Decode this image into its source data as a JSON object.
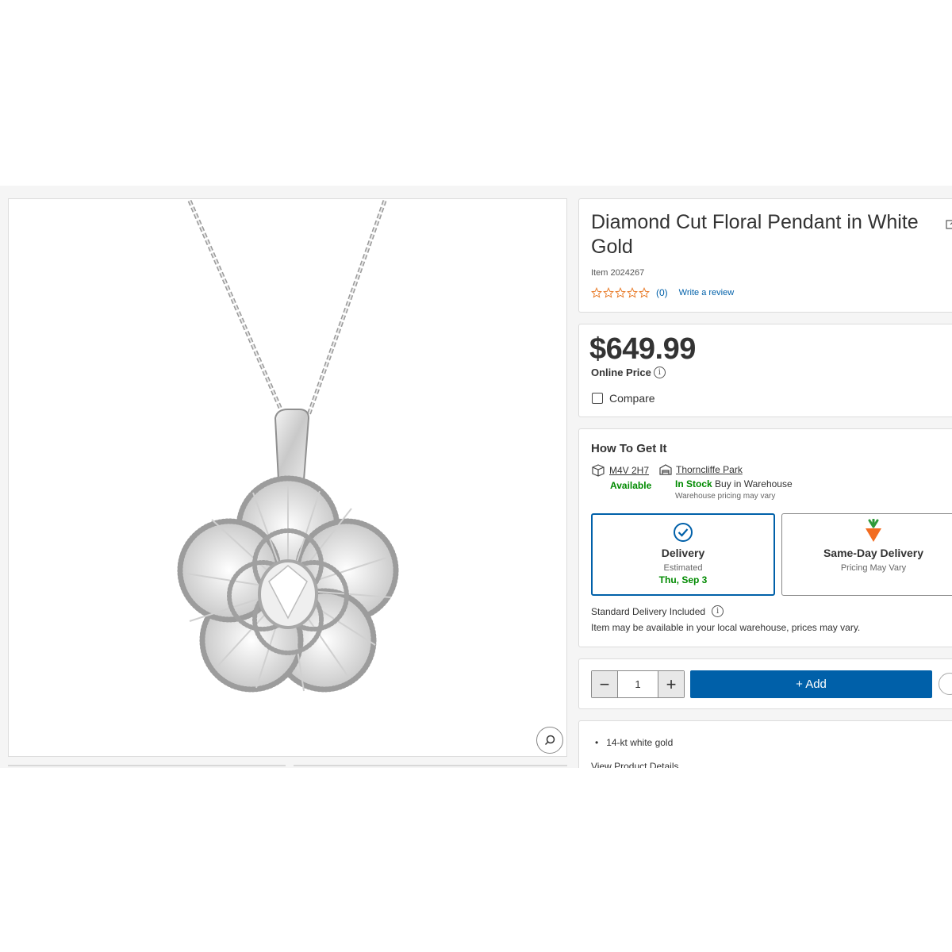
{
  "product": {
    "title": "Diamond Cut Floral Pendant in White Gold",
    "item_number": "Item 2024267",
    "review_count": "(0)",
    "write_review": "Write a review",
    "price": "$649.99",
    "price_label": "Online Price",
    "compare_label": "Compare"
  },
  "fulfillment": {
    "title": "How To Get It",
    "postal_code": "M4V 2H7",
    "postal_status": "Available",
    "warehouse_name": "Thorncliffe Park",
    "warehouse_stock": "In Stock",
    "warehouse_action": "Buy in Warehouse",
    "warehouse_note": "Warehouse pricing may vary",
    "delivery": {
      "label": "Delivery",
      "estimated": "Estimated",
      "date": "Thu, Sep 3"
    },
    "same_day": {
      "label": "Same-Day Delivery",
      "note": "Pricing May Vary"
    },
    "standard_delivery": "Standard Delivery Included",
    "availability_note": "Item may be available in your local warehouse, prices may vary."
  },
  "cart": {
    "quantity": "1",
    "minus": "−",
    "plus": "+",
    "add_label": "+ Add"
  },
  "details": {
    "bullet": "14-kt white gold",
    "view_details": "View Product Details"
  },
  "colors": {
    "brand_blue": "#0060a9",
    "stock_green": "#008a00",
    "star_orange": "#e87722"
  },
  "icons": [
    "zoom-icon",
    "share-icon",
    "star-icon",
    "info-icon",
    "box-icon",
    "warehouse-icon",
    "check-circle-icon",
    "carrot-icon",
    "heart-icon"
  ]
}
